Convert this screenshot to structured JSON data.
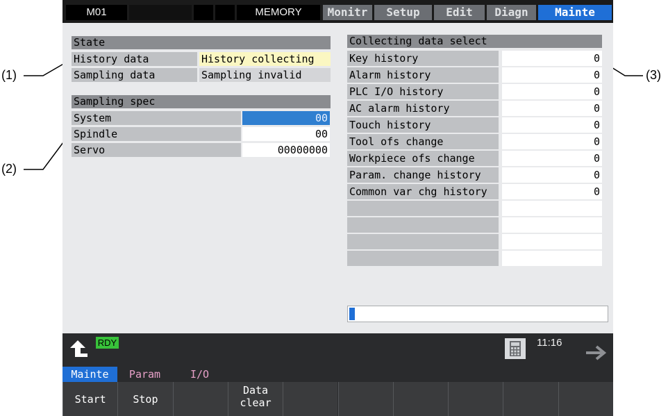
{
  "callouts": {
    "c1": "(1)",
    "c2": "(2)",
    "c3": "(3)"
  },
  "topbar": {
    "program": "M01",
    "mode": "MEMORY",
    "menus": [
      "Monitr",
      "Setup",
      "Edit",
      "Diagn",
      "Mainte"
    ],
    "active_menu": "Mainte"
  },
  "state": {
    "header": "State",
    "rows": [
      {
        "label": "History data",
        "value": "History collecting"
      },
      {
        "label": "Sampling data",
        "value": "Sampling invalid"
      }
    ]
  },
  "sampling_spec": {
    "header": "Sampling spec",
    "rows": [
      {
        "label": "System",
        "value": "00"
      },
      {
        "label": "Spindle",
        "value": "00"
      },
      {
        "label": "Servo",
        "value": "00000000"
      }
    ]
  },
  "collecting": {
    "header": "Collecting data select",
    "rows": [
      {
        "label": "Key history",
        "value": "0"
      },
      {
        "label": "Alarm history",
        "value": "0"
      },
      {
        "label": "PLC I/O history",
        "value": "0"
      },
      {
        "label": "AC alarm history",
        "value": "0"
      },
      {
        "label": "Touch history",
        "value": "0"
      },
      {
        "label": "Tool ofs change",
        "value": "0"
      },
      {
        "label": "Workpiece ofs change",
        "value": "0"
      },
      {
        "label": "Param. change history",
        "value": "0"
      },
      {
        "label": "Common var chg history",
        "value": "0"
      }
    ]
  },
  "progress": {
    "fraction": 0.02
  },
  "status": {
    "ready": "RDY",
    "time": "11:16"
  },
  "softkeys": {
    "top": [
      "Mainte",
      "Param",
      "I/O"
    ],
    "keys": [
      [
        "Start"
      ],
      [
        "Stop"
      ],
      [
        ""
      ],
      [
        "Data",
        "clear"
      ],
      [
        ""
      ],
      [
        ""
      ],
      [
        ""
      ],
      [
        ""
      ],
      [
        ""
      ],
      [
        ""
      ]
    ]
  },
  "icons": {
    "up": "up-arrow-icon",
    "next": "right-arrow-icon",
    "calc": "calculator-icon"
  },
  "colors": {
    "accent": "#1f6fd6",
    "highlight": "#fbf7c2",
    "ready": "#38c23a"
  }
}
